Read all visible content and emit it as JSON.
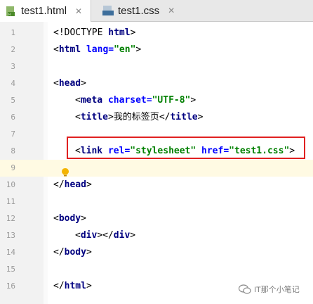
{
  "tabs": [
    {
      "label": "test1.html",
      "icon": "html-file-icon",
      "active": true,
      "close": "✕"
    },
    {
      "label": "test1.css",
      "icon": "css-file-icon",
      "active": false,
      "close": "✕"
    }
  ],
  "css_icon_text": "css",
  "lines": [
    {
      "n": "1"
    },
    {
      "n": "2"
    },
    {
      "n": "3"
    },
    {
      "n": "4"
    },
    {
      "n": "5"
    },
    {
      "n": "6"
    },
    {
      "n": "7"
    },
    {
      "n": "8"
    },
    {
      "n": "9"
    },
    {
      "n": "10"
    },
    {
      "n": "11"
    },
    {
      "n": "12"
    },
    {
      "n": "13"
    },
    {
      "n": "14"
    },
    {
      "n": "15"
    },
    {
      "n": "16"
    }
  ],
  "code": {
    "l1": {
      "open": "<!DOCTYPE ",
      "kw": "html",
      "close": ">"
    },
    "l2": {
      "lt": "<",
      "tag": "html",
      "attr": " lang=",
      "val": "\"en\"",
      "gt": ">"
    },
    "l4": {
      "lt": "<",
      "tag": "head",
      "gt": ">"
    },
    "l5": {
      "lt": "<",
      "tag": "meta",
      "attr": " charset=",
      "val": "\"UTF-8\"",
      "gt": ">"
    },
    "l6": {
      "lt": "<",
      "tag": "title",
      "gt": ">",
      "text": "我的标签页",
      "endlt": "</",
      "endtag": "title",
      "endgt": ">"
    },
    "l8": {
      "lt": "<",
      "tag": "link",
      "attr1": " rel=",
      "val1": "\"stylesheet\"",
      "attr2": " href=",
      "val2": "\"test1.css\"",
      "gt": ">"
    },
    "l10": {
      "lt": "</",
      "tag": "head",
      "gt": ">"
    },
    "l12": {
      "lt": "<",
      "tag": "body",
      "gt": ">"
    },
    "l13": {
      "lt": "<",
      "tag": "div",
      "gt": ">",
      "endlt": "</",
      "endtag": "div",
      "endgt": ">"
    },
    "l14": {
      "lt": "</",
      "tag": "body",
      "gt": ">"
    },
    "l16": {
      "lt": "</",
      "tag": "html",
      "gt": ">"
    }
  },
  "watermark": {
    "text": "IT那个小笔记",
    "icon": "wechat-icon"
  },
  "colors": {
    "highlight": "#e02020",
    "tag": "#000080",
    "attr": "#0000ff",
    "value": "#008000"
  }
}
